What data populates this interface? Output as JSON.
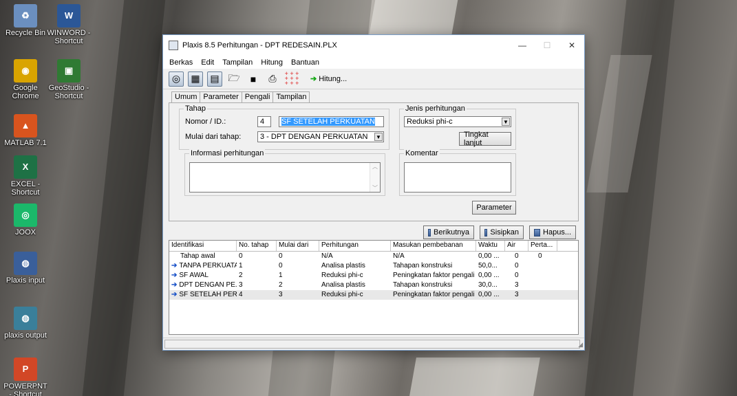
{
  "desktop": {
    "icons": [
      {
        "label": "Recycle Bin",
        "icon": "recycle-bin-icon",
        "color": "#6b8fbf"
      },
      {
        "label": "WINWORD - Shortcut",
        "icon": "word-icon",
        "color": "#2b5797"
      },
      {
        "label": "Google Chrome",
        "icon": "chrome-icon",
        "color": "#d9a400"
      },
      {
        "label": "GeoStudio - Shortcut",
        "icon": "geostudio-icon",
        "color": "#2f7a33"
      },
      {
        "label": "MATLAB 7.1",
        "icon": "matlab-icon",
        "color": "#d9541e"
      },
      {
        "label": "EXCEL - Shortcut",
        "icon": "excel-icon",
        "color": "#1e7145"
      },
      {
        "label": "JOOX",
        "icon": "joox-icon",
        "color": "#1bb86a"
      },
      {
        "label": "Plaxis input",
        "icon": "plaxis-input-icon",
        "color": "#3a5f9a"
      },
      {
        "label": "plaxis output",
        "icon": "plaxis-output-icon",
        "color": "#3a7f9a"
      },
      {
        "label": "POWERPNT - Shortcut",
        "icon": "powerpoint-icon",
        "color": "#d24726"
      }
    ]
  },
  "window": {
    "title": "Plaxis 8.5 Perhitungan - DPT REDESAIN.PLX",
    "minimize": "—",
    "maximize": "☐",
    "close": "✕"
  },
  "menu": [
    "Berkas",
    "Edit",
    "Tampilan",
    "Hitung",
    "Bantuan"
  ],
  "toolbar": {
    "hitung_label": "Hitung..."
  },
  "tabs": [
    "Umum",
    "Parameter",
    "Pengali",
    "Tampilan"
  ],
  "tahap": {
    "group_label": "Tahap",
    "nomor_label": "Nomor / ID.:",
    "nomor_value": "4",
    "id_value": "SF SETELAH PERKUATAN",
    "mulai_label": "Mulai dari tahap:",
    "mulai_value": "3 - DPT DENGAN PERKUATAN"
  },
  "jenis": {
    "group_label": "Jenis perhitungan",
    "value": "Reduksi phi-c",
    "tingkat_button": "Tingkat lanjut"
  },
  "informasi": {
    "group_label": "Informasi perhitungan"
  },
  "komentar": {
    "group_label": "Komentar"
  },
  "parameter_button": "Parameter",
  "actions": {
    "berikutnya": "Berikutnya",
    "sisipkan": "Sisipkan",
    "hapus": "Hapus..."
  },
  "phases": {
    "headers": [
      "Identifikasi",
      "No. tahap",
      "Mulai dari",
      "Perhitungan",
      "Masukan pembebanan",
      "Waktu",
      "Air",
      "Perta..."
    ],
    "rows": [
      {
        "id": "Tahap awal",
        "no": "0",
        "from": "0",
        "calc": "N/A",
        "load": "N/A",
        "time": "0,00 ...",
        "water": "0",
        "first": "0",
        "arrow": false
      },
      {
        "id": "TANPA PERKUATAN",
        "no": "1",
        "from": "0",
        "calc": "Analisa plastis",
        "load": "Tahapan konstruksi",
        "time": "50,0...",
        "water": "0",
        "first": "",
        "arrow": true
      },
      {
        "id": "SF AWAL",
        "no": "2",
        "from": "1",
        "calc": "Reduksi phi-c",
        "load": "Peningkatan faktor pengali",
        "time": "0,00 ...",
        "water": "0",
        "first": "",
        "arrow": true
      },
      {
        "id": "DPT DENGAN PE...",
        "no": "3",
        "from": "2",
        "calc": "Analisa plastis",
        "load": "Tahapan konstruksi",
        "time": "30,0...",
        "water": "3",
        "first": "",
        "arrow": true
      },
      {
        "id": "SF SETELAH PER...",
        "no": "4",
        "from": "3",
        "calc": "Reduksi phi-c",
        "load": "Peningkatan faktor pengali",
        "time": "0,00 ...",
        "water": "3",
        "first": "",
        "arrow": true
      }
    ]
  }
}
